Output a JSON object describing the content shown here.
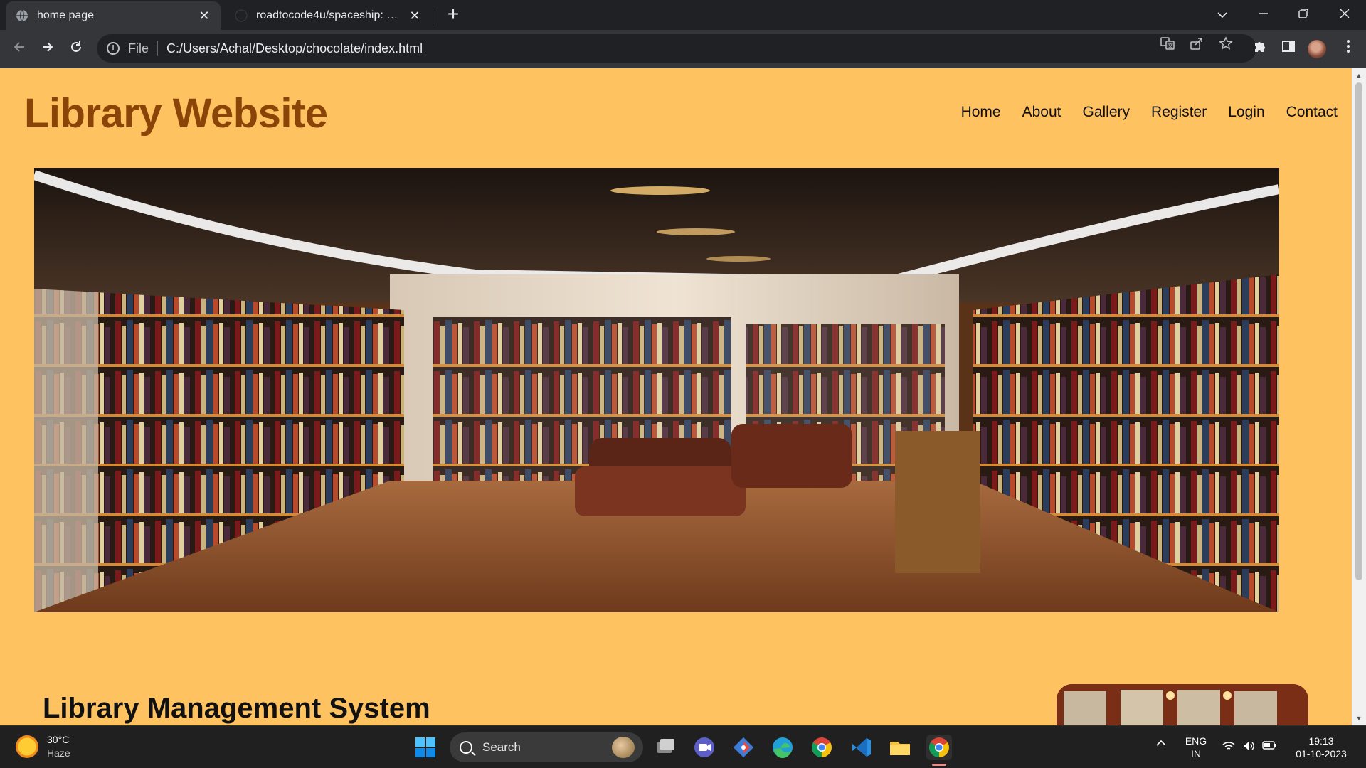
{
  "browser": {
    "tabs": [
      {
        "title": "home page",
        "active": true
      },
      {
        "title": "roadtocode4u/spaceship: Spaceship",
        "active": false
      }
    ],
    "address": {
      "scheme": "File",
      "url": "C:/Users/Achal/Desktop/chocolate/index.html"
    },
    "icons": {
      "tab_list": "chevron-down-icon",
      "minimize": "minimize-icon",
      "restore": "restore-icon",
      "close": "close-icon",
      "back": "back-arrow-icon",
      "forward": "forward-arrow-icon",
      "reload": "reload-icon",
      "translate": "translate-icon",
      "share": "share-icon",
      "bookmark": "star-icon",
      "extensions": "puzzle-icon",
      "side_panel": "side-panel-icon",
      "profile": "avatar",
      "menu": "kebab-menu-icon"
    }
  },
  "page": {
    "site_title": "Library Website",
    "nav": [
      "Home",
      "About",
      "Gallery",
      "Register",
      "Login",
      "Contact"
    ],
    "section_title": "Library Management System",
    "colors": {
      "background": "#ffc261",
      "title": "#8b4408"
    }
  },
  "taskbar": {
    "weather": {
      "temp": "30°C",
      "condition": "Haze"
    },
    "search_placeholder": "Search",
    "tray": {
      "lang": "ENG",
      "region": "IN",
      "time": "19:13",
      "date": "01-10-2023"
    },
    "apps": [
      "start-icon",
      "task-view-icon",
      "meet-icon",
      "git-icon",
      "edge-icon",
      "chrome-icon",
      "vscode-icon",
      "file-explorer-icon",
      "chrome-active-icon"
    ]
  }
}
